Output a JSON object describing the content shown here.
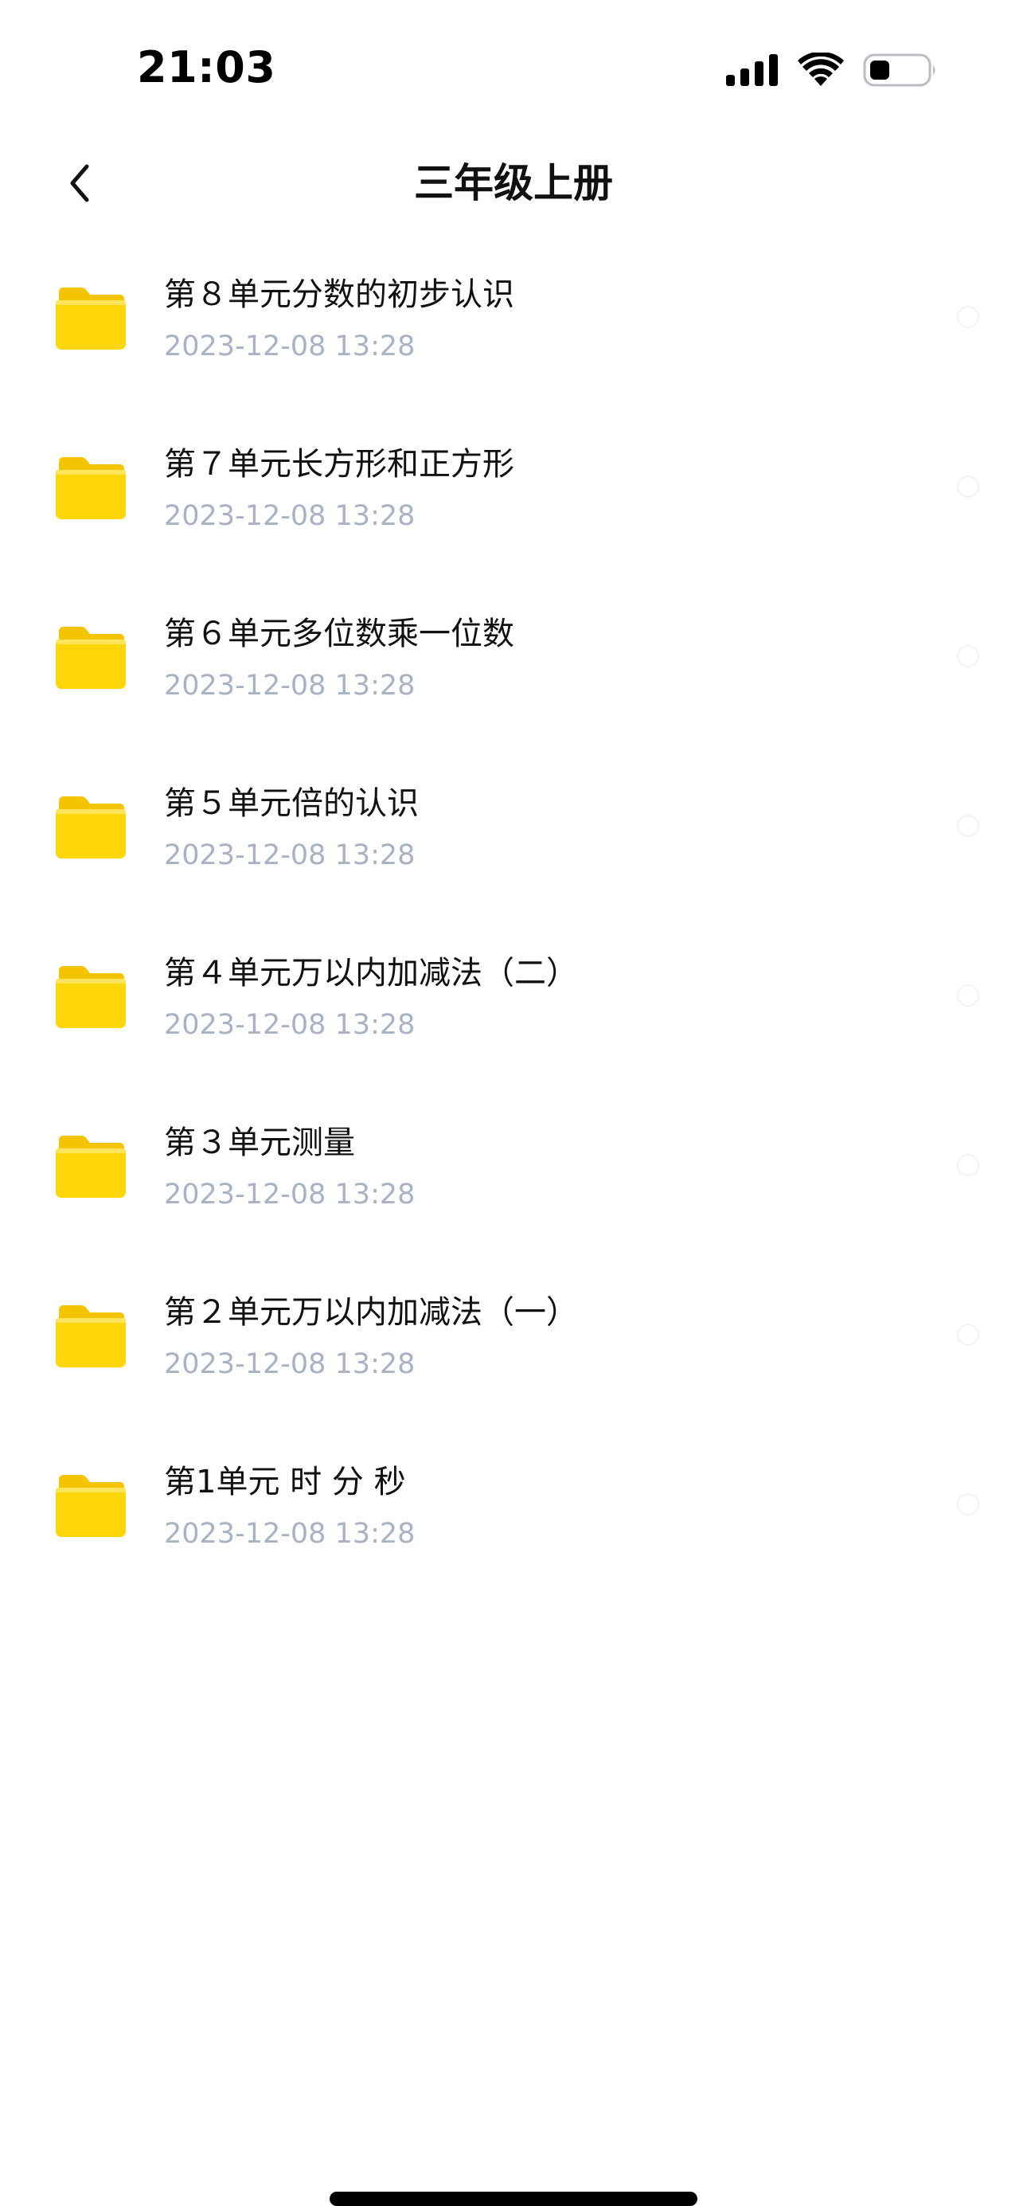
{
  "status_bar": {
    "time": "21:03"
  },
  "nav": {
    "title": "三年级上册",
    "back_icon": "chevron-left-icon"
  },
  "folders": [
    {
      "name": "第８单元分数的初步认识",
      "date": "2023-12-08 13:28"
    },
    {
      "name": "第７单元长方形和正方形",
      "date": "2023-12-08 13:28"
    },
    {
      "name": "第６单元多位数乘一位数",
      "date": "2023-12-08 13:28"
    },
    {
      "name": "第５单元倍的认识",
      "date": "2023-12-08 13:28"
    },
    {
      "name": "第４单元万以内加减法（二）",
      "date": "2023-12-08 13:28"
    },
    {
      "name": "第３单元测量",
      "date": "2023-12-08 13:28"
    },
    {
      "name": "第２单元万以内加减法（一）",
      "date": "2023-12-08 13:28"
    },
    {
      "name": "第1单元 时 分 秒",
      "date": "2023-12-08 13:28"
    }
  ],
  "colors": {
    "folder_icon": "#FFD60A",
    "folder_icon_back": "#F5C400",
    "date_text": "#A9B2C2",
    "title_text": "#111111"
  }
}
